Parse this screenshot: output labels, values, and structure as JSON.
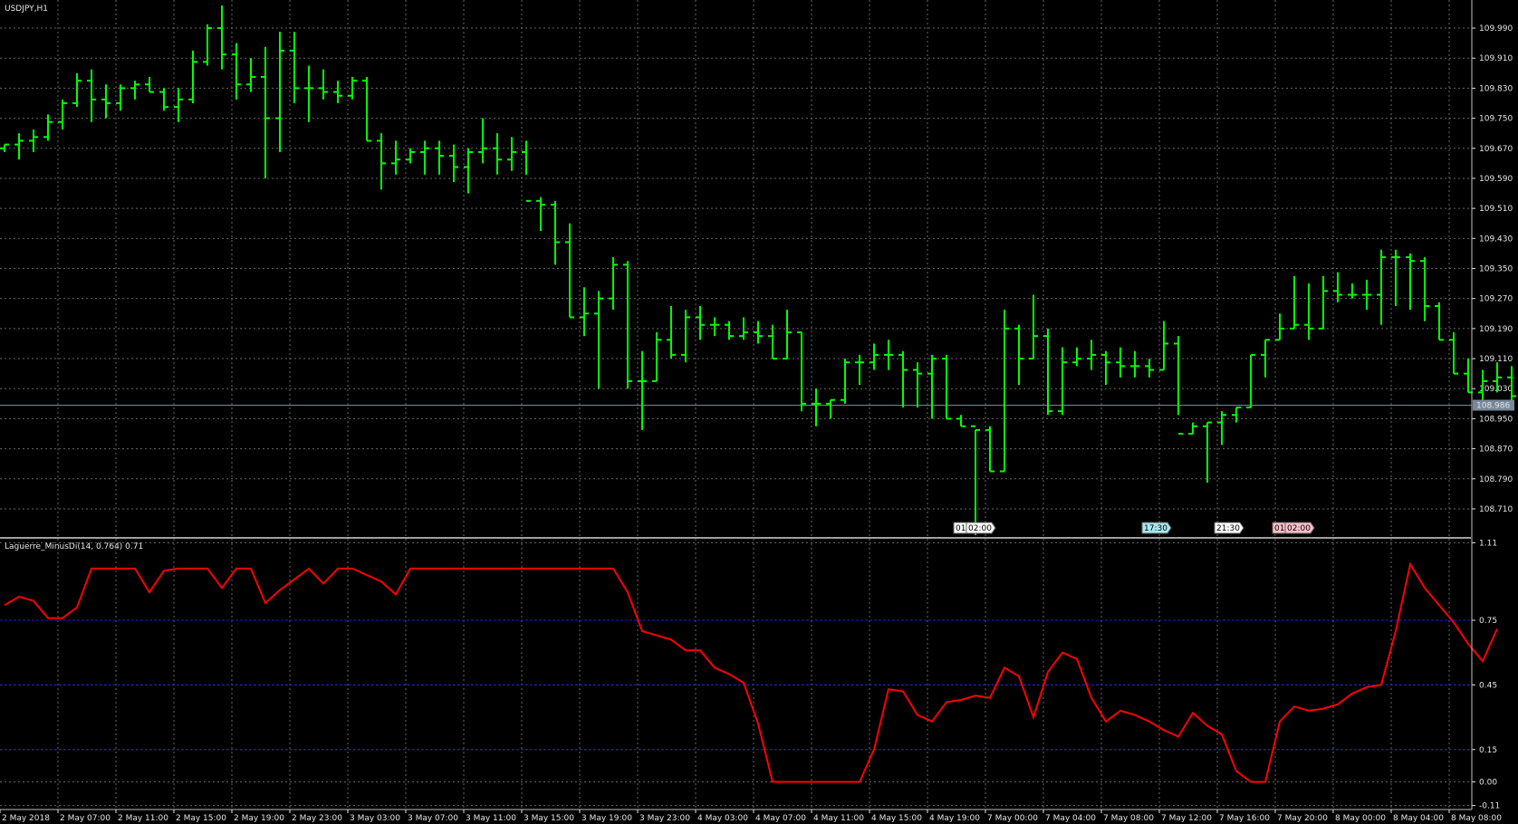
{
  "window": {
    "main_title": "USDJPY,H1",
    "indicator_title": "Laguerre_MinusDi(14, 0.764) 0.71"
  },
  "colors": {
    "background": "#000000",
    "bar": "#00ff00",
    "indicator_line": "#ff0000",
    "level_line": "#1a1ad8",
    "grid": "#808080",
    "axis_text": "#e6e6e6",
    "price_line": "#778899",
    "price_badge": "#778899"
  },
  "current_price_label": "108.986",
  "time_markers": [
    {
      "text_left": "01",
      "text_right": "02:00",
      "bar": 66,
      "style": "white"
    },
    {
      "text_left": "",
      "text_right": "17:30",
      "bar": 79,
      "style": "cyan"
    },
    {
      "text_left": "",
      "text_right": "21:30",
      "bar": 84,
      "style": "white"
    },
    {
      "text_left": "01",
      "text_right": "02:00",
      "bar": 88,
      "style": "pink"
    }
  ],
  "chart_data": [
    {
      "type": "ohlc",
      "series_label": "USDJPY,H1",
      "ylim": [
        108.64,
        110.06
      ],
      "y_ticks": [
        "109.990",
        "109.910",
        "109.830",
        "109.750",
        "109.670",
        "109.590",
        "109.510",
        "109.430",
        "109.350",
        "109.270",
        "109.190",
        "109.110",
        "109.030",
        "108.950",
        "108.870",
        "108.790",
        "108.710"
      ],
      "y_tick_values": [
        109.99,
        109.91,
        109.83,
        109.75,
        109.67,
        109.59,
        109.51,
        109.43,
        109.35,
        109.27,
        109.19,
        109.11,
        109.03,
        108.95,
        108.87,
        108.79,
        108.71
      ],
      "current_price": 108.986,
      "x_labels": [
        "2 May 2018",
        "2 May 07:00",
        "2 May 11:00",
        "2 May 15:00",
        "2 May 19:00",
        "2 May 23:00",
        "3 May 03:00",
        "3 May 07:00",
        "3 May 11:00",
        "3 May 15:00",
        "3 May 19:00",
        "3 May 23:00",
        "4 May 03:00",
        "4 May 07:00",
        "4 May 11:00",
        "4 May 15:00",
        "4 May 19:00",
        "7 May 00:00",
        "7 May 04:00",
        "7 May 08:00",
        "7 May 12:00",
        "7 May 16:00",
        "7 May 20:00",
        "8 May 00:00",
        "8 May 04:00",
        "8 May 08:00"
      ],
      "bars": [
        {
          "o": 109.67,
          "h": 109.68,
          "l": 109.66,
          "c": 109.68
        },
        {
          "o": 109.68,
          "h": 109.71,
          "l": 109.64,
          "c": 109.69
        },
        {
          "o": 109.69,
          "h": 109.72,
          "l": 109.66,
          "c": 109.7
        },
        {
          "o": 109.7,
          "h": 109.76,
          "l": 109.69,
          "c": 109.74
        },
        {
          "o": 109.74,
          "h": 109.8,
          "l": 109.72,
          "c": 109.79
        },
        {
          "o": 109.79,
          "h": 109.87,
          "l": 109.78,
          "c": 109.85
        },
        {
          "o": 109.85,
          "h": 109.88,
          "l": 109.74,
          "c": 109.8
        },
        {
          "o": 109.8,
          "h": 109.84,
          "l": 109.75,
          "c": 109.79
        },
        {
          "o": 109.79,
          "h": 109.84,
          "l": 109.77,
          "c": 109.83
        },
        {
          "o": 109.83,
          "h": 109.85,
          "l": 109.8,
          "c": 109.84
        },
        {
          "o": 109.84,
          "h": 109.86,
          "l": 109.82,
          "c": 109.82
        },
        {
          "o": 109.82,
          "h": 109.83,
          "l": 109.77,
          "c": 109.78
        },
        {
          "o": 109.78,
          "h": 109.83,
          "l": 109.74,
          "c": 109.8
        },
        {
          "o": 109.8,
          "h": 109.93,
          "l": 109.79,
          "c": 109.9
        },
        {
          "o": 109.9,
          "h": 110.0,
          "l": 109.89,
          "c": 109.99
        },
        {
          "o": 109.99,
          "h": 110.05,
          "l": 109.88,
          "c": 109.92
        },
        {
          "o": 109.92,
          "h": 109.95,
          "l": 109.8,
          "c": 109.84
        },
        {
          "o": 109.84,
          "h": 109.91,
          "l": 109.82,
          "c": 109.86
        },
        {
          "o": 109.86,
          "h": 109.94,
          "l": 109.59,
          "c": 109.75
        },
        {
          "o": 109.75,
          "h": 109.98,
          "l": 109.66,
          "c": 109.93
        },
        {
          "o": 109.93,
          "h": 109.98,
          "l": 109.79,
          "c": 109.83
        },
        {
          "o": 109.83,
          "h": 109.89,
          "l": 109.74,
          "c": 109.83
        },
        {
          "o": 109.83,
          "h": 109.88,
          "l": 109.8,
          "c": 109.82
        },
        {
          "o": 109.82,
          "h": 109.85,
          "l": 109.79,
          "c": 109.81
        },
        {
          "o": 109.81,
          "h": 109.86,
          "l": 109.8,
          "c": 109.85
        },
        {
          "o": 109.85,
          "h": 109.86,
          "l": 109.69,
          "c": 109.69
        },
        {
          "o": 109.69,
          "h": 109.71,
          "l": 109.56,
          "c": 109.63
        },
        {
          "o": 109.63,
          "h": 109.69,
          "l": 109.6,
          "c": 109.64
        },
        {
          "o": 109.64,
          "h": 109.67,
          "l": 109.63,
          "c": 109.66
        },
        {
          "o": 109.66,
          "h": 109.69,
          "l": 109.6,
          "c": 109.67
        },
        {
          "o": 109.67,
          "h": 109.69,
          "l": 109.6,
          "c": 109.65
        },
        {
          "o": 109.65,
          "h": 109.68,
          "l": 109.58,
          "c": 109.62
        },
        {
          "o": 109.62,
          "h": 109.67,
          "l": 109.55,
          "c": 109.66
        },
        {
          "o": 109.66,
          "h": 109.75,
          "l": 109.63,
          "c": 109.67
        },
        {
          "o": 109.67,
          "h": 109.71,
          "l": 109.6,
          "c": 109.64
        },
        {
          "o": 109.64,
          "h": 109.7,
          "l": 109.61,
          "c": 109.66
        },
        {
          "o": 109.66,
          "h": 109.69,
          "l": 109.6,
          "c": 109.53
        },
        {
          "o": 109.53,
          "h": 109.54,
          "l": 109.45,
          "c": 109.52
        },
        {
          "o": 109.52,
          "h": 109.53,
          "l": 109.36,
          "c": 109.42
        },
        {
          "o": 109.42,
          "h": 109.47,
          "l": 109.22,
          "c": 109.22
        },
        {
          "o": 109.22,
          "h": 109.3,
          "l": 109.17,
          "c": 109.23
        },
        {
          "o": 109.23,
          "h": 109.29,
          "l": 109.03,
          "c": 109.27
        },
        {
          "o": 109.27,
          "h": 109.38,
          "l": 109.24,
          "c": 109.36
        },
        {
          "o": 109.36,
          "h": 109.37,
          "l": 109.03,
          "c": 109.05
        },
        {
          "o": 109.05,
          "h": 109.13,
          "l": 108.92,
          "c": 109.05
        },
        {
          "o": 109.05,
          "h": 109.18,
          "l": 109.05,
          "c": 109.16
        },
        {
          "o": 109.16,
          "h": 109.25,
          "l": 109.11,
          "c": 109.12
        },
        {
          "o": 109.12,
          "h": 109.24,
          "l": 109.1,
          "c": 109.22
        },
        {
          "o": 109.22,
          "h": 109.25,
          "l": 109.16,
          "c": 109.2
        },
        {
          "o": 109.2,
          "h": 109.22,
          "l": 109.17,
          "c": 109.2
        },
        {
          "o": 109.2,
          "h": 109.21,
          "l": 109.16,
          "c": 109.17
        },
        {
          "o": 109.17,
          "h": 109.22,
          "l": 109.16,
          "c": 109.18
        },
        {
          "o": 109.18,
          "h": 109.21,
          "l": 109.15,
          "c": 109.17
        },
        {
          "o": 109.17,
          "h": 109.2,
          "l": 109.11,
          "c": 109.11
        },
        {
          "o": 109.11,
          "h": 109.24,
          "l": 109.11,
          "c": 109.18
        },
        {
          "o": 109.18,
          "h": 109.18,
          "l": 108.97,
          "c": 108.99
        },
        {
          "o": 108.99,
          "h": 109.03,
          "l": 108.93,
          "c": 108.99
        },
        {
          "o": 108.99,
          "h": 109.0,
          "l": 108.95,
          "c": 109.0
        },
        {
          "o": 109.0,
          "h": 109.11,
          "l": 108.99,
          "c": 109.1
        },
        {
          "o": 109.1,
          "h": 109.12,
          "l": 109.04,
          "c": 109.1
        },
        {
          "o": 109.1,
          "h": 109.15,
          "l": 109.08,
          "c": 109.12
        },
        {
          "o": 109.12,
          "h": 109.16,
          "l": 109.08,
          "c": 109.12
        },
        {
          "o": 109.12,
          "h": 109.13,
          "l": 108.98,
          "c": 109.08
        },
        {
          "o": 109.08,
          "h": 109.1,
          "l": 108.98,
          "c": 109.07
        },
        {
          "o": 109.07,
          "h": 109.12,
          "l": 108.95,
          "c": 109.11
        },
        {
          "o": 109.11,
          "h": 109.12,
          "l": 108.95,
          "c": 108.95
        },
        {
          "o": 108.95,
          "h": 108.96,
          "l": 108.93,
          "c": 108.93
        },
        {
          "o": 108.93,
          "h": 108.92,
          "l": 108.64,
          "c": 108.92
        },
        {
          "o": 108.92,
          "h": 108.93,
          "l": 108.81,
          "c": 108.81
        },
        {
          "o": 108.81,
          "h": 109.24,
          "l": 108.81,
          "c": 109.19
        },
        {
          "o": 109.19,
          "h": 109.2,
          "l": 109.04,
          "c": 109.11
        },
        {
          "o": 109.11,
          "h": 109.28,
          "l": 109.11,
          "c": 109.17
        },
        {
          "o": 109.17,
          "h": 109.19,
          "l": 108.96,
          "c": 108.97
        },
        {
          "o": 108.97,
          "h": 109.14,
          "l": 108.96,
          "c": 109.1
        },
        {
          "o": 109.1,
          "h": 109.14,
          "l": 109.09,
          "c": 109.11
        },
        {
          "o": 109.11,
          "h": 109.16,
          "l": 109.08,
          "c": 109.12
        },
        {
          "o": 109.12,
          "h": 109.13,
          "l": 109.04,
          "c": 109.1
        },
        {
          "o": 109.1,
          "h": 109.14,
          "l": 109.06,
          "c": 109.09
        },
        {
          "o": 109.09,
          "h": 109.13,
          "l": 109.06,
          "c": 109.09
        },
        {
          "o": 109.09,
          "h": 109.11,
          "l": 109.06,
          "c": 109.08
        },
        {
          "o": 109.08,
          "h": 109.21,
          "l": 109.08,
          "c": 109.15
        },
        {
          "o": 109.15,
          "h": 109.17,
          "l": 108.96,
          "c": 108.91
        },
        {
          "o": 108.91,
          "h": 108.94,
          "l": 108.91,
          "c": 108.93
        },
        {
          "o": 108.93,
          "h": 108.94,
          "l": 108.78,
          "c": 108.94
        },
        {
          "o": 108.94,
          "h": 108.97,
          "l": 108.88,
          "c": 108.96
        },
        {
          "o": 108.96,
          "h": 108.98,
          "l": 108.94,
          "c": 108.98
        },
        {
          "o": 108.98,
          "h": 109.12,
          "l": 108.98,
          "c": 109.12
        },
        {
          "o": 109.12,
          "h": 109.16,
          "l": 109.06,
          "c": 109.16
        },
        {
          "o": 109.16,
          "h": 109.23,
          "l": 109.16,
          "c": 109.19
        },
        {
          "o": 109.19,
          "h": 109.33,
          "l": 109.19,
          "c": 109.2
        },
        {
          "o": 109.2,
          "h": 109.31,
          "l": 109.16,
          "c": 109.19
        },
        {
          "o": 109.19,
          "h": 109.33,
          "l": 109.19,
          "c": 109.29
        },
        {
          "o": 109.29,
          "h": 109.34,
          "l": 109.26,
          "c": 109.28
        },
        {
          "o": 109.28,
          "h": 109.31,
          "l": 109.27,
          "c": 109.28
        },
        {
          "o": 109.28,
          "h": 109.32,
          "l": 109.24,
          "c": 109.28
        },
        {
          "o": 109.28,
          "h": 109.4,
          "l": 109.2,
          "c": 109.38
        },
        {
          "o": 109.38,
          "h": 109.4,
          "l": 109.25,
          "c": 109.38
        },
        {
          "o": 109.38,
          "h": 109.39,
          "l": 109.24,
          "c": 109.37
        },
        {
          "o": 109.37,
          "h": 109.38,
          "l": 109.21,
          "c": 109.25
        },
        {
          "o": 109.25,
          "h": 109.26,
          "l": 109.16,
          "c": 109.16
        },
        {
          "o": 109.16,
          "h": 109.18,
          "l": 109.07,
          "c": 109.07
        },
        {
          "o": 109.07,
          "h": 109.11,
          "l": 109.02,
          "c": 109.02
        },
        {
          "o": 109.02,
          "h": 109.08,
          "l": 108.99,
          "c": 109.05
        },
        {
          "o": 109.05,
          "h": 109.1,
          "l": 109.02,
          "c": 109.06
        },
        {
          "o": 109.06,
          "h": 109.09,
          "l": 108.99,
          "c": 109.01
        },
        {
          "o": 109.01,
          "h": 109.1,
          "l": 109.01,
          "c": 109.09
        },
        {
          "o": 109.09,
          "h": 109.11,
          "l": 108.99,
          "c": 109.09
        },
        {
          "o": 109.09,
          "h": 109.09,
          "l": 108.99,
          "c": 109.1
        },
        {
          "o": 109.1,
          "h": 109.14,
          "l": 109.05,
          "c": 109.14
        },
        {
          "o": 109.14,
          "h": 109.15,
          "l": 108.95,
          "c": 108.94
        },
        {
          "o": 108.94,
          "h": 108.95,
          "l": 108.87,
          "c": 108.95
        },
        {
          "o": 108.95,
          "h": 108.99,
          "l": 108.87,
          "c": 108.88
        },
        {
          "o": 108.88,
          "h": 109.03,
          "l": 108.86,
          "c": 108.96
        },
        {
          "o": 108.96,
          "h": 108.99,
          "l": 108.88,
          "c": 108.97
        },
        {
          "o": 108.97,
          "h": 109.03,
          "l": 108.9,
          "c": 108.95
        },
        {
          "o": 108.95,
          "h": 109.03,
          "l": 108.93,
          "c": 109.01
        },
        {
          "o": 109.01,
          "h": 109.11,
          "l": 109.03,
          "c": 109.04
        },
        {
          "o": 109.04,
          "h": 109.1,
          "l": 109.0,
          "c": 109.01
        },
        {
          "o": 109.01,
          "h": 109.02,
          "l": 108.92,
          "c": 108.97
        }
      ]
    },
    {
      "type": "line",
      "series_label": "Laguerre_MinusDi(14, 0.764) 0.71",
      "ylim": [
        -0.12,
        1.12
      ],
      "y_ticks": [
        "1.11",
        "0.75",
        "0.45",
        "0.15",
        "0.00",
        "-0.11"
      ],
      "y_tick_values": [
        1.11,
        0.75,
        0.45,
        0.15,
        0.0,
        -0.11
      ],
      "levels": [
        0.75,
        0.45,
        0.15
      ],
      "values": [
        0.82,
        0.86,
        0.84,
        0.76,
        0.76,
        0.81,
        0.99,
        0.99,
        0.99,
        0.99,
        0.88,
        0.98,
        0.99,
        0.99,
        0.99,
        0.9,
        0.99,
        0.99,
        0.83,
        0.89,
        0.94,
        0.99,
        0.92,
        0.99,
        0.99,
        0.96,
        0.93,
        0.87,
        0.99,
        0.99,
        0.99,
        0.99,
        0.99,
        0.99,
        0.99,
        0.99,
        0.99,
        0.99,
        0.99,
        0.99,
        0.99,
        0.99,
        0.99,
        0.88,
        0.7,
        0.68,
        0.66,
        0.61,
        0.61,
        0.53,
        0.5,
        0.46,
        0.27,
        0.0,
        0.0,
        0.0,
        0.0,
        0.0,
        0.0,
        0.0,
        0.15,
        0.43,
        0.42,
        0.31,
        0.28,
        0.37,
        0.38,
        0.4,
        0.39,
        0.53,
        0.49,
        0.3,
        0.51,
        0.6,
        0.57,
        0.39,
        0.28,
        0.33,
        0.31,
        0.28,
        0.24,
        0.21,
        0.32,
        0.26,
        0.22,
        0.05,
        0.0,
        0.0,
        0.28,
        0.35,
        0.33,
        0.34,
        0.36,
        0.41,
        0.44,
        0.45,
        0.7,
        1.01,
        0.9,
        0.82,
        0.74,
        0.64,
        0.56,
        0.71
      ]
    }
  ]
}
